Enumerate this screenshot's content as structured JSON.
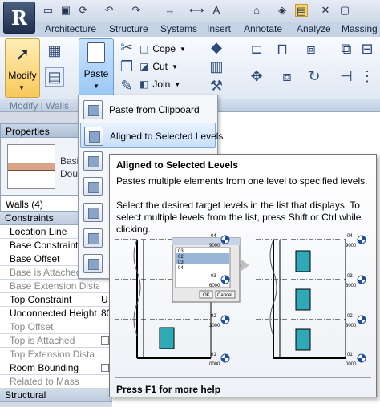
{
  "app": {
    "logo": "R"
  },
  "qat": {
    "icons": [
      "open-icon",
      "save-icon",
      "sync-icon",
      "undo-icon",
      "redo-icon",
      "measure-icon",
      "dimension-icon",
      "text-icon",
      "3d-view-icon",
      "section-icon",
      "window-tile-icon",
      "close-windows-icon",
      "switch-windows-icon"
    ]
  },
  "tabs": [
    "Architecture",
    "Structure",
    "Systems",
    "Insert",
    "Annotate",
    "Analyze",
    "Massing"
  ],
  "ribbon": {
    "modify_label": "Modify",
    "paste_label": "Paste",
    "cope_label": "Cope",
    "cut_label": "Cut",
    "join_label": "Join"
  },
  "panel_bar": {
    "label": "Modify | Walls"
  },
  "properties": {
    "header": "Properties",
    "type_line1": "Basi",
    "type_line2": "Dou",
    "selector": "Walls (4)",
    "rows": [
      {
        "kind": "cat",
        "label": "Constraints"
      },
      {
        "kind": "row",
        "label": "Location Line",
        "value": "W",
        "dim": false
      },
      {
        "kind": "row",
        "label": "Base Constraint",
        "value": "",
        "dim": false
      },
      {
        "kind": "row",
        "label": "Base Offset",
        "value": "",
        "dim": false
      },
      {
        "kind": "row",
        "label": "Base is Attached",
        "value": "",
        "dim": true
      },
      {
        "kind": "row",
        "label": "Base Extension Dista...",
        "value": "",
        "dim": true
      },
      {
        "kind": "row",
        "label": "Top Constraint",
        "value": "U",
        "dim": false
      },
      {
        "kind": "row",
        "label": "Unconnected Height",
        "value": "80",
        "dim": false
      },
      {
        "kind": "row",
        "label": "Top Offset",
        "value": "",
        "dim": true
      },
      {
        "kind": "row",
        "label": "Top is Attached",
        "value": "",
        "dim": true,
        "check": true
      },
      {
        "kind": "row",
        "label": "Top Extension Dista...",
        "value": "",
        "dim": true
      },
      {
        "kind": "row",
        "label": "Room Bounding",
        "value": "",
        "dim": false,
        "check": true
      },
      {
        "kind": "row",
        "label": "Related to Mass",
        "value": "",
        "dim": true
      },
      {
        "kind": "cat",
        "label": "Structural"
      }
    ]
  },
  "dropdown": {
    "items": [
      {
        "label": "Paste from Clipboard",
        "state": "normal"
      },
      {
        "label": "Aligned to Selected Levels",
        "state": "highlight"
      },
      {
        "label": "A",
        "state": "disabled"
      },
      {
        "label": "A",
        "state": "normal"
      },
      {
        "label": "A",
        "state": "normal"
      },
      {
        "label": "A",
        "state": "normal"
      },
      {
        "label": "A",
        "state": "normal"
      }
    ]
  },
  "tooltip": {
    "title": "Aligned to Selected Levels",
    "description": "Pastes multiple elements from one level to specified levels.",
    "detail": "Select the desired target levels in the list that displays. To select multiple levels from the list, press Shift or Ctrl while clicking.",
    "help": "Press F1 for more help",
    "figure": {
      "levels": [
        "04",
        "03",
        "02",
        "01"
      ],
      "elevations": [
        "9000",
        "6000",
        "3000",
        "0000"
      ],
      "dialog_items": [
        "03",
        "02",
        "03",
        "04"
      ],
      "ok_label": "OK",
      "cancel_label": "Cancel"
    }
  }
}
